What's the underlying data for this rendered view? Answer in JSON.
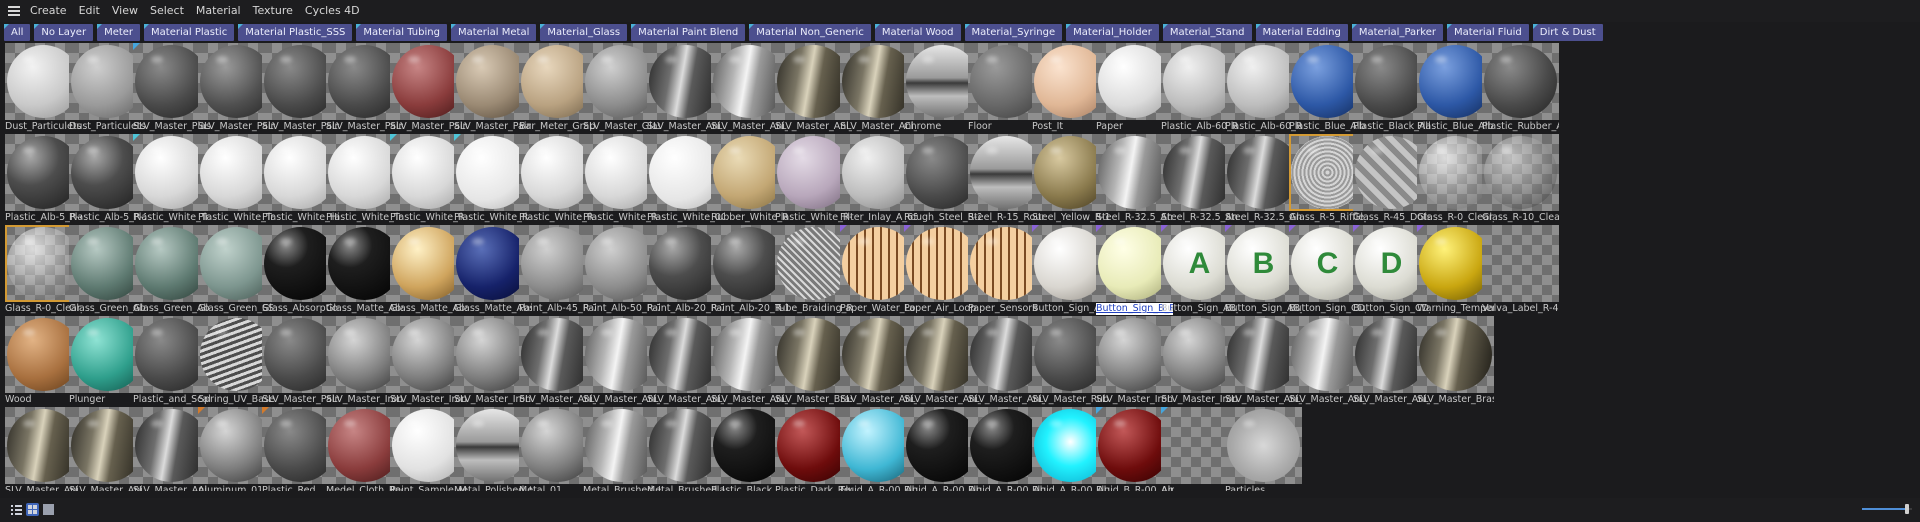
{
  "menubar": {
    "items": [
      "Create",
      "Edit",
      "View",
      "Select",
      "Material",
      "Texture",
      "Cycles 4D"
    ]
  },
  "tags": [
    "All",
    "No Layer",
    "Meter",
    "Material Plastic",
    "Material Plastic_SSS",
    "Material Tubing",
    "Material Metal",
    "Material_Glass",
    "Material Paint Blend",
    "Material Non_Generic",
    "Material Wood",
    "Material_Syringe",
    "Material_Holder",
    "Material_Stand",
    "Material Edding",
    "Material_Parker",
    "Material Fluid",
    "Dirt & Dust"
  ],
  "materials": [
    [
      {
        "name": "Dust_Particulets",
        "look": "dust-light"
      },
      {
        "name": "Dust_Particulets",
        "look": "dust-dark"
      },
      {
        "name": "SLV_Master_Plastic",
        "look": "dark-matte",
        "tag": "blue"
      },
      {
        "name": "SLV_Master_Paint",
        "look": "speckle"
      },
      {
        "name": "SLV_Master_Paint",
        "look": "dark-matte"
      },
      {
        "name": "SLV_Master_Paint",
        "look": "dark-matte"
      },
      {
        "name": "SLV_Master_Paint",
        "look": "red-matte"
      },
      {
        "name": "SLV_Master_Paint",
        "look": "granite"
      },
      {
        "name": "Bar_Meter_Graphi",
        "look": "beige"
      },
      {
        "name": "SLV_Master_Glass",
        "look": "mid-gray"
      },
      {
        "name": "SLV_Master_Ani_L",
        "look": "brushed"
      },
      {
        "name": "SLV_Master_Ani_R",
        "look": "brushed-light"
      },
      {
        "name": "SLV_Master_Ani_L",
        "look": "brushed-gold"
      },
      {
        "name": "SLV_Master_Ani_R",
        "look": "brushed-gold"
      },
      {
        "name": "Chrome",
        "look": "chrome"
      },
      {
        "name": "Floor",
        "look": "floor-gray"
      },
      {
        "name": "Post_It",
        "look": "peach"
      },
      {
        "name": "Paper",
        "look": "paper"
      },
      {
        "name": "Plastic_Alb-60_R-4",
        "look": "light-gray"
      },
      {
        "name": "Plastic_Alb-60_R-3",
        "look": "light-gray"
      },
      {
        "name": "Plastic_Blue_Alb-3",
        "look": "blue"
      },
      {
        "name": "Plastic_Black_Alb-",
        "look": "dark-matte"
      },
      {
        "name": "Plastic_Blue_Alb-3",
        "look": "blue"
      },
      {
        "name": "Plastic_Rubber_Al",
        "look": "dark-matte"
      }
    ],
    [
      {
        "name": "Plastic_Alb-5_R-4(",
        "look": "dark-gloss"
      },
      {
        "name": "Plastic_Alb-5_R-2(",
        "look": "dark-gloss"
      },
      {
        "name": "Plastic_White_Tran",
        "look": "white",
        "tag": "teal"
      },
      {
        "name": "Plastic_White_Tran",
        "look": "white"
      },
      {
        "name": "Plastic_White_Hig",
        "look": "white"
      },
      {
        "name": "Plastic_White_Tran",
        "look": "white"
      },
      {
        "name": "Plastic_White_R-3",
        "look": "white",
        "tag": "teal"
      },
      {
        "name": "Plastic_White_R-5",
        "look": "white-bright",
        "tag": "teal"
      },
      {
        "name": "Plastic_White_R-3",
        "look": "white"
      },
      {
        "name": "Plastic_White_R-4",
        "look": "white"
      },
      {
        "name": "Plastic_White_00_",
        "look": "white-bright"
      },
      {
        "name": "Rubber_White_R-5",
        "look": "tan"
      },
      {
        "name": "Plastic_White_R-0",
        "look": "lilac"
      },
      {
        "name": "Filter_Inlay_A_65_I",
        "look": "light-gray"
      },
      {
        "name": "Rough_Steel_R-22",
        "look": "dark-matte"
      },
      {
        "name": "Steel_R-15_Round",
        "look": "chrome"
      },
      {
        "name": "Steel_Yellow_R-15",
        "look": "brass"
      },
      {
        "name": "Steel_R-32.5_Ani_L",
        "look": "brushed-light"
      },
      {
        "name": "Steel_R-32.5_Ani_L",
        "look": "brushed"
      },
      {
        "name": "Steel_R-32.5_Ani_L",
        "look": "brushed"
      },
      {
        "name": "Glass_R-5_Riffle_P",
        "look": "riffle",
        "selected": true
      },
      {
        "name": "Glass_R-45_Dots_I",
        "look": "dots"
      },
      {
        "name": "Glass_R-0_Clear_F",
        "look": "glass"
      },
      {
        "name": "Glass_R-10_Clear_",
        "look": "glass-dark"
      }
    ],
    [
      {
        "name": "Glass_R-0_Clear_F",
        "look": "glass",
        "selected": true
      },
      {
        "name": "Glass_Green_Abs-",
        "look": "green-glass"
      },
      {
        "name": "Glass_Green_Abs-",
        "look": "green-glass"
      },
      {
        "name": "Glass_Green_SSS-",
        "look": "green-sss"
      },
      {
        "name": "Glass_Absorption_",
        "look": "black-gloss"
      },
      {
        "name": "Glass_Matte_Absc",
        "look": "black-gloss"
      },
      {
        "name": "Glass_Matte_Absc",
        "look": "amber"
      },
      {
        "name": "Glass_Matte_Absc",
        "look": "navy"
      },
      {
        "name": "Paint_Alb-45_R-7.",
        "look": "mid-gray"
      },
      {
        "name": "Paint_Alb-50_R-7.",
        "look": "mid-gray"
      },
      {
        "name": "Paint_Alb-20_R-7.",
        "look": "dark-gloss"
      },
      {
        "name": "Paint_Alb-20_R-1",
        "look": "dark-gloss"
      },
      {
        "name": "Tube_Braiding_R-",
        "look": "braid"
      },
      {
        "name": "Paper_Water_Loop",
        "look": "paper-stripes",
        "tag": "purple"
      },
      {
        "name": "Paper_Air_Loop",
        "look": "paper-stripes",
        "tag": "purple"
      },
      {
        "name": "Paper_Sensors",
        "look": "paper-stripes"
      },
      {
        "name": "Button_Sign_A_R-",
        "look": "sign-red",
        "tag": "purple"
      },
      {
        "name": "Button_Sign_B_R-",
        "look": "sign-yellow",
        "tag": "purple",
        "selected_name": true
      },
      {
        "name": "Button_Sign_AB_A",
        "look": "sign",
        "glyph": "A",
        "tag": "purple"
      },
      {
        "name": "Button_Sign_AB_B",
        "look": "sign",
        "glyph": "B",
        "tag": "purple"
      },
      {
        "name": "Button_Sign_CD_A",
        "look": "sign",
        "glyph": "C",
        "tag": "purple"
      },
      {
        "name": "Button_Sign_CD_E",
        "look": "sign",
        "glyph": "D",
        "tag": "purple"
      },
      {
        "name": "Warning_Tempera",
        "look": "warning",
        "tag": "purple"
      },
      {
        "name": "Valva_Label_R-40",
        "look": "empty"
      }
    ],
    [
      {
        "name": "Wood",
        "look": "wood"
      },
      {
        "name": "Plunger",
        "look": "teal"
      },
      {
        "name": "Plastic_and_Scale",
        "look": "dark-matte"
      },
      {
        "name": "Spring_UV_Based",
        "look": "spring"
      },
      {
        "name": "SLV_Master_Paint",
        "look": "dark-matte"
      },
      {
        "name": "SLV_Master_Iron_I",
        "look": "iron"
      },
      {
        "name": "SLV_Master_Iron_",
        "look": "iron"
      },
      {
        "name": "SLV_Master_Iron_",
        "look": "iron"
      },
      {
        "name": "SLV_Master_Ani_L",
        "look": "brushed"
      },
      {
        "name": "SLV_Master_Ani_R",
        "look": "brushed-light"
      },
      {
        "name": "SLV_Master_Ani_L",
        "look": "brushed"
      },
      {
        "name": "SLV_Master_Ani_R",
        "look": "brushed-light"
      },
      {
        "name": "SLV_Master_Brass",
        "look": "brushed-gold"
      },
      {
        "name": "SLV_Master_Ani_L",
        "look": "brushed-gold"
      },
      {
        "name": "SLV_Master_Ani_R",
        "look": "brushed-gold"
      },
      {
        "name": "SLV_Master_Ani_L",
        "look": "brushed"
      },
      {
        "name": "SLV_Master_Rubb",
        "look": "dark-matte"
      },
      {
        "name": "SLV_Master_Iron_",
        "look": "iron"
      },
      {
        "name": "SLV_Master_Iron_",
        "look": "iron"
      },
      {
        "name": "SLV_Master_Ani_L",
        "look": "brushed"
      },
      {
        "name": "SLV_Master_Ani_R",
        "look": "brushed-light"
      },
      {
        "name": "SLV_Master_Ani_L",
        "look": "brushed"
      },
      {
        "name": "SLV_Master_Brass",
        "look": "brushed-gold"
      }
    ],
    [
      {
        "name": "SLV_Master_Ani_L",
        "look": "brushed-gold"
      },
      {
        "name": "SLV_Master_Ani_R",
        "look": "brushed-gold"
      },
      {
        "name": "SLV_Master_Ani_L",
        "look": "brushed"
      },
      {
        "name": "Aluminum_01",
        "look": "iron",
        "tag": "orange"
      },
      {
        "name": "Plastic_Red",
        "look": "dark-matte",
        "tag": "orange"
      },
      {
        "name": "Medel_Cloth_Red",
        "look": "red-matte"
      },
      {
        "name": "Paint_Sample_Ma",
        "look": "label-ball"
      },
      {
        "name": "Metal_Polished_Sl",
        "look": "chrome"
      },
      {
        "name": "Metal_01",
        "look": "iron"
      },
      {
        "name": "Metal_Brushed_Li",
        "look": "brushed-light"
      },
      {
        "name": "Metal_Brushed_Da",
        "look": "brushed"
      },
      {
        "name": "Plastic_Black",
        "look": "black-gloss"
      },
      {
        "name": "Plastic_Dark_Red",
        "look": "dark-red"
      },
      {
        "name": "Fluid_A_R-00_Abs",
        "look": "cyan-glass"
      },
      {
        "name": "Fluid_A_R-00_Abs",
        "look": "black-gloss"
      },
      {
        "name": "Fluid_A_R-00_Abs",
        "look": "black-gloss"
      },
      {
        "name": "Fluid_A_R-00_Abs",
        "look": "cyan-bright"
      },
      {
        "name": "Fluid_B_R-00_Abs",
        "look": "dark-red",
        "tag": "blue"
      },
      {
        "name": "Air",
        "look": "empty",
        "tag": "blue"
      },
      {
        "name": "Particles",
        "look": "particles"
      }
    ]
  ],
  "statusbar": {
    "view_modes": [
      "list-view-icon",
      "grid-view-icon",
      "large-view-icon"
    ],
    "zoom_fraction": 0.9
  }
}
